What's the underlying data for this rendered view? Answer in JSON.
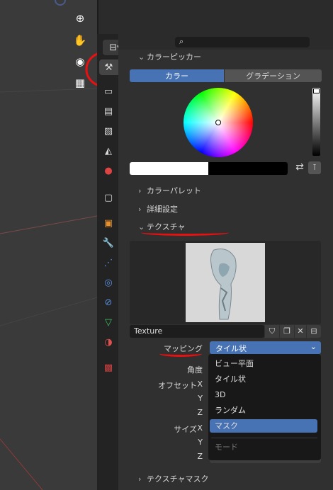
{
  "toolbar": {
    "tools": [
      "zoom-icon",
      "hand-icon",
      "camera-icon",
      "grid-icon"
    ]
  },
  "tabs": [
    "tool",
    "render",
    "output",
    "view-layer",
    "scene",
    "world",
    "collection",
    "object",
    "modifiers",
    "particles",
    "physics",
    "constraints",
    "data",
    "material",
    "texture"
  ],
  "header": {
    "search_placeholder": ""
  },
  "color_picker": {
    "title": "カラーピッカー",
    "mode_color": "カラー",
    "mode_gradient": "グラデーション"
  },
  "sections": {
    "palette": "カラーパレット",
    "advanced": "詳細設定",
    "texture": "テクスチャ",
    "texture_mask": "テクスチャマスク"
  },
  "texture": {
    "name": "Texture",
    "mapping_label": "マッピング",
    "mapping_value": "タイル状",
    "angle_label": "角度",
    "offset_label": "オフセット",
    "size_label": "サイズ",
    "x": "X",
    "y": "Y",
    "z": "Z"
  },
  "dropdown": {
    "items": [
      "ビュー平面",
      "タイル状",
      "3D",
      "ランダム",
      "マスク"
    ],
    "selected": "マスク",
    "footer": "モード"
  },
  "colors": {
    "accent": "#4772b3",
    "annotation": "#e81010"
  }
}
